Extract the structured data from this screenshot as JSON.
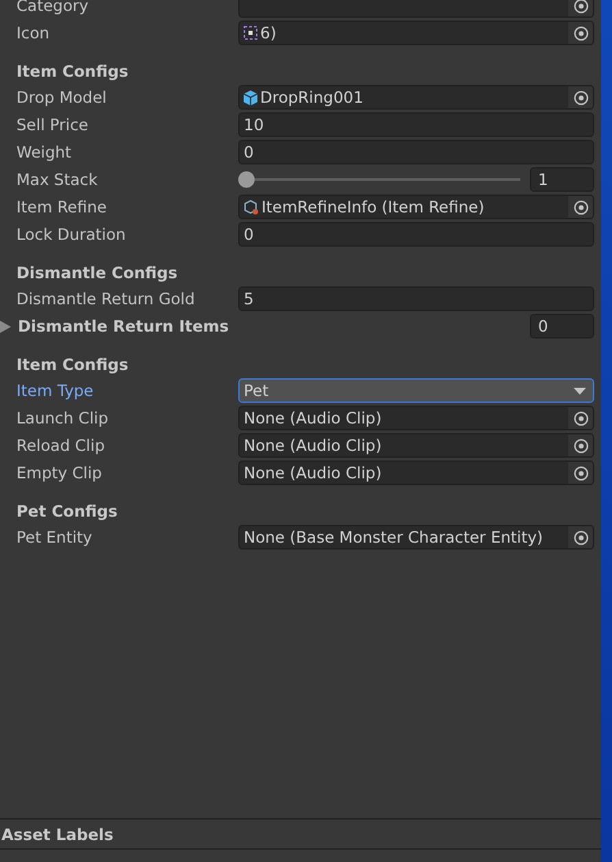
{
  "sections": [
    {
      "fields": [
        {
          "kind": "object",
          "label": "Category"
        },
        {
          "kind": "sprite",
          "label": "Icon",
          "value": "6)"
        }
      ]
    },
    {
      "title": "Item Configs",
      "fields": [
        {
          "kind": "prefab",
          "label": "Drop Model",
          "value": "DropRing001"
        },
        {
          "kind": "text",
          "label": "Sell Price",
          "value": "10"
        },
        {
          "kind": "text",
          "label": "Weight",
          "value": "0"
        },
        {
          "kind": "slider",
          "label": "Max Stack",
          "value": "1",
          "level": 0
        },
        {
          "kind": "asset",
          "label": "Item Refine",
          "value": "ItemRefineInfo (Item Refine)"
        },
        {
          "kind": "text",
          "label": "Lock Duration",
          "value": "0"
        }
      ]
    },
    {
      "title": "Dismantle Configs",
      "fields": [
        {
          "kind": "text",
          "label": "Dismantle Return Gold",
          "value": "5"
        },
        {
          "kind": "foldout",
          "label": "Dismantle Return Items",
          "value": "0",
          "expanded": false
        }
      ]
    },
    {
      "title": "Item Configs",
      "fields": [
        {
          "kind": "dropdown",
          "label": "Item Type",
          "value": "Pet",
          "focused": true
        },
        {
          "kind": "object",
          "label": "Launch Clip",
          "value": "None (Audio Clip)"
        },
        {
          "kind": "object",
          "label": "Reload Clip",
          "value": "None (Audio Clip)"
        },
        {
          "kind": "object",
          "label": "Empty Clip",
          "value": "None (Audio Clip)"
        }
      ]
    },
    {
      "title": "Pet Configs",
      "fields": [
        {
          "kind": "object",
          "label": "Pet Entity",
          "value": "None (Base Monster Character Entity)"
        }
      ]
    }
  ],
  "footer": {
    "title": "Asset Labels"
  }
}
